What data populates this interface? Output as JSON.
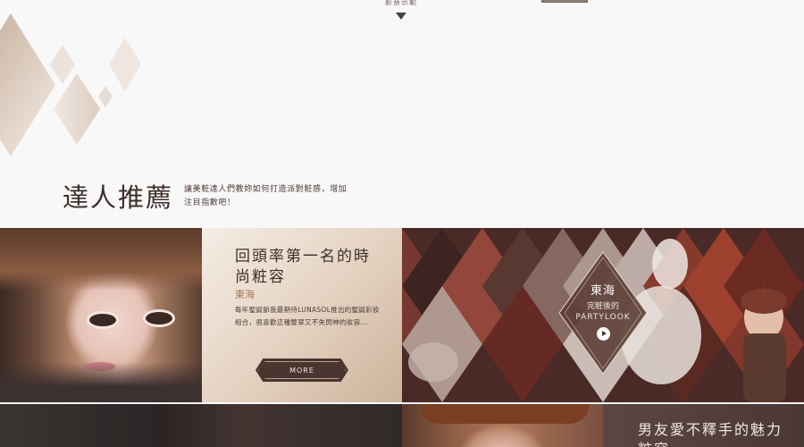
{
  "header": {
    "video_link_label": "影音示範"
  },
  "section": {
    "title": "達人推薦",
    "description": "讓美粧達人們教妳如何打造派對粧感，增加注目指數吧！"
  },
  "story_card": {
    "title": "回頭率第一名的時尚粧容",
    "author": "東海",
    "body": "每年聖誕節我最期待LUNASOL推出的聖誕彩妝組合，很喜歡這種雙翠又不失閃神的妝容...",
    "more_label": "MORE"
  },
  "video_badge": {
    "name": "東海",
    "line1": "完粧後的",
    "line2": "PARTYLOOK"
  },
  "row2": {
    "right_title": "男友愛不釋手的魅力粧容"
  },
  "colors": {
    "accent": "#4a3530",
    "card_gold": "#cdb39b",
    "author_gold": "#a37a55"
  }
}
